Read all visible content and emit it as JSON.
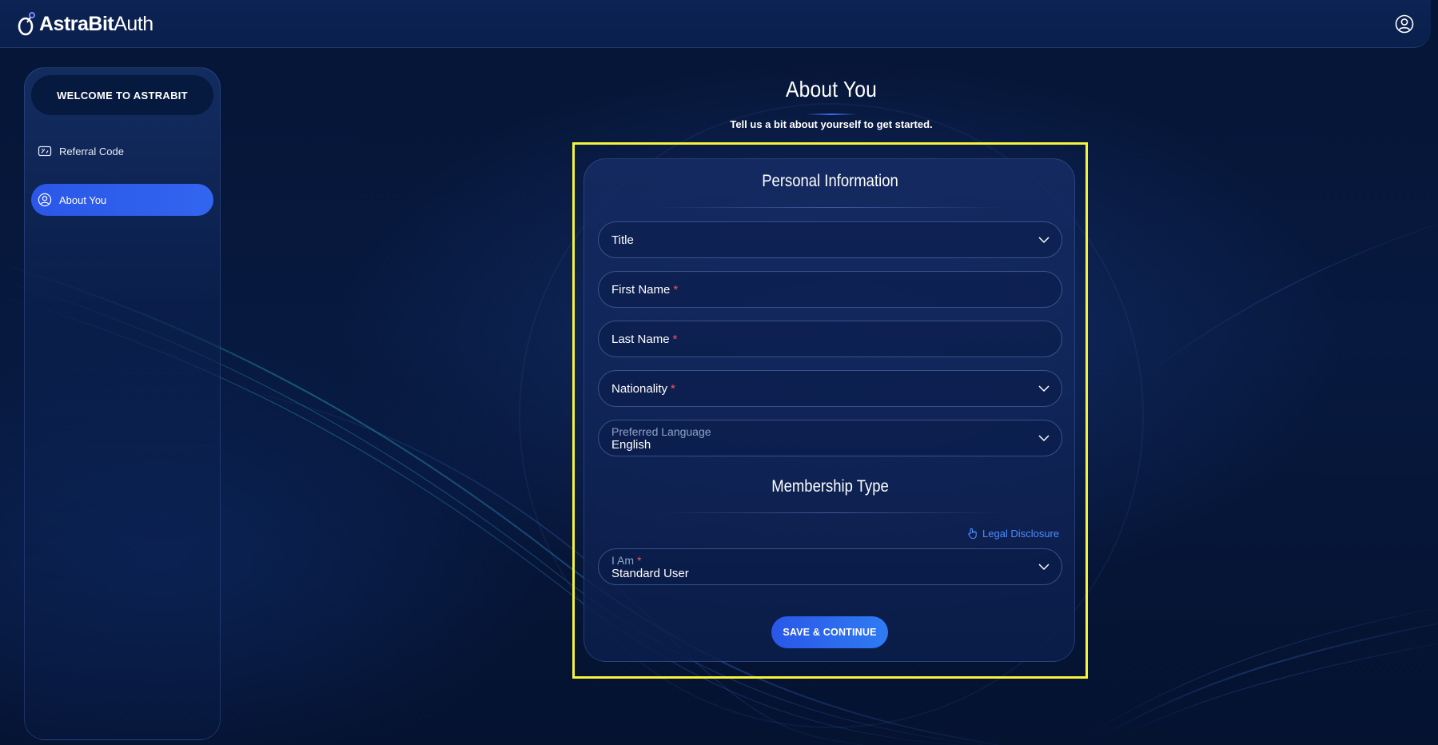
{
  "header": {
    "logo_bold": "AstraBit",
    "logo_thin": "Auth",
    "profile_icon": "user-circle-icon"
  },
  "sidebar": {
    "welcome": "WELCOME TO ASTRABIT",
    "items": [
      {
        "label": "Referral Code",
        "icon": "ticket-icon",
        "active": false
      },
      {
        "label": "About You",
        "icon": "user-circle-icon",
        "active": true
      }
    ]
  },
  "main": {
    "title": "About You",
    "subtitle": "Tell us a bit about yourself to get started."
  },
  "form": {
    "personal_section": "Personal Information",
    "title_field": {
      "label": "Title"
    },
    "first_name": {
      "label": "First Name",
      "required": "*"
    },
    "last_name": {
      "label": "Last Name",
      "required": "*"
    },
    "nationality": {
      "label": "Nationality",
      "required": "*"
    },
    "preferred_language": {
      "label": "Preferred Language",
      "value": "English"
    },
    "membership_section": "Membership Type",
    "legal_disclosure": "Legal Disclosure",
    "i_am": {
      "label": "I Am",
      "required": "*",
      "value": "Standard User"
    },
    "save_button": "SAVE & CONTINUE"
  },
  "colors": {
    "accent": "#2a57e8",
    "highlight_frame": "#f7f23a",
    "required": "#ff4d5e",
    "link": "#4f8cff"
  }
}
